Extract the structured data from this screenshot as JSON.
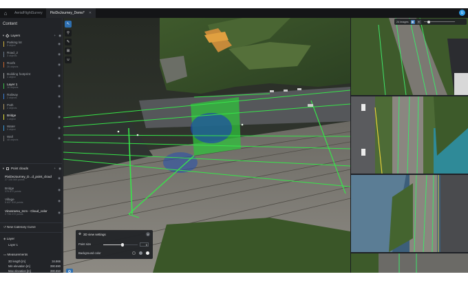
{
  "tabs": [
    {
      "label": "AerialFlightSurvey",
      "active": false
    },
    {
      "label": "PixiDeJourney_Demo*",
      "active": true
    }
  ],
  "user_initial": "U",
  "panel": {
    "title": "Content",
    "layers_section": "Layers",
    "layers": [
      {
        "name": "Parking lot",
        "sub": "5 object",
        "color": "#d1b23e"
      },
      {
        "name": "Road_2",
        "sub": "3 objects",
        "color": "#6b7a8a"
      },
      {
        "name": "Roofs",
        "sub": "26 objects",
        "color": "#c9662e"
      },
      {
        "name": "Building footprint",
        "sub": "1 object",
        "color": "#a2a2a2"
      },
      {
        "name": "Layer 1",
        "sub": "16 objects",
        "color": "#3dbd4a",
        "bright": true
      },
      {
        "name": "Railway",
        "sub": "2 objects",
        "color": "#3a7fd6"
      },
      {
        "name": "Path",
        "sub": "2 objects",
        "color": "#b39a63"
      },
      {
        "name": "Bridge",
        "sub": "1 object",
        "color": "#e6e039",
        "bright": true
      },
      {
        "name": "Water",
        "sub": "9 object",
        "color": "#3a9ad9"
      },
      {
        "name": "Wall",
        "sub": "48 objects",
        "color": "#6c6c6c"
      }
    ],
    "pointclouds_section": "Point clouds",
    "pointclouds": [
      {
        "name": "PixiDeJourney_D...d_point_cloud",
        "sub": "27 108 569 points",
        "bright": true
      },
      {
        "name": "Bridge",
        "sub": "376 872 points"
      },
      {
        "name": "Village",
        "sub": "5 637 510 points"
      },
      {
        "name": "Vinosrama_2cm - Cloud_color",
        "sub": "2 736 272 points",
        "bright": true
      }
    ],
    "new_catenary": "New Catenary Curve",
    "layer_label": "Layer",
    "layer_value": "Layer 1",
    "measurements_label": "Measurements",
    "measurements": [
      {
        "label": "3D length [m]",
        "value": "34.866"
      },
      {
        "label": "Min elevation [m]",
        "value": "390.690"
      },
      {
        "label": "Max elevation [m]",
        "value": "390.650"
      }
    ]
  },
  "viewport": {
    "tools": [
      "cursor-icon",
      "pin-icon",
      "pencil-icon",
      "box-icon",
      "curve-icon"
    ],
    "settings": {
      "title": "3D view settings",
      "point_size_label": "Point size",
      "point_size_value": "5",
      "point_size_fraction": 0.55,
      "background_label": "Background color",
      "background_options": [
        "#2a2d31",
        "#8a8f96",
        "#f1f1f1"
      ]
    }
  },
  "right_toolbar": {
    "label": "24 images"
  },
  "colors": {
    "accent": "#2e6fb0",
    "vector_green": "#37e64a"
  }
}
